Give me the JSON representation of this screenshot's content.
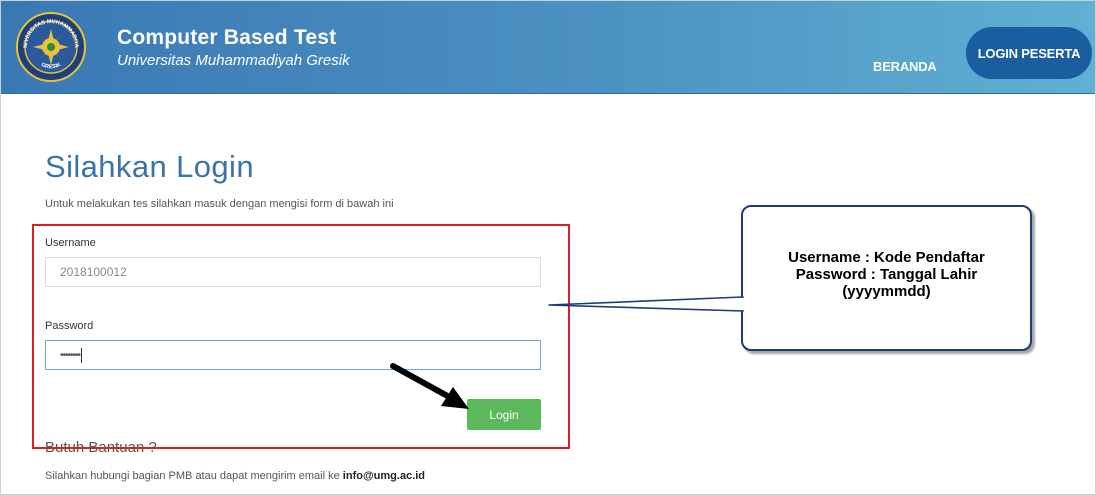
{
  "header": {
    "title": "Computer Based Test",
    "subtitle": "Universitas Muhammadiyah Gresik",
    "nav_home": "BERANDA",
    "nav_login": "LOGIN PESERTA",
    "logo_text_top": "UNIVERSITAS MUHAMMADIYAH",
    "logo_text_bottom": "GRESIK"
  },
  "main": {
    "title": "Silahkan Login",
    "description": "Untuk melakukan tes silahkan masuk dengan mengisi form di bawah ini",
    "username_label": "Username",
    "username_value": "2018100012",
    "password_label": "Password",
    "password_value": "••••••••",
    "login_button": "Login",
    "help_title": "Butuh Bantuan ?",
    "help_text": "Silahkan hubungi bagian PMB atau dapat mengirim email ke ",
    "help_email": "info@umg.ac.id"
  },
  "callout": {
    "line1": "Username : Kode Pendaftar",
    "line2": "Password : Tanggal Lahir",
    "line3": "(yyyymmdd)"
  },
  "colors": {
    "header_gradient_start": "#3a78b4",
    "header_gradient_end": "#5fb1d3",
    "title_blue": "#3a73a8",
    "login_green": "#5cb85c",
    "highlight_red": "#e01c24",
    "callout_border": "#1f3a7a"
  }
}
